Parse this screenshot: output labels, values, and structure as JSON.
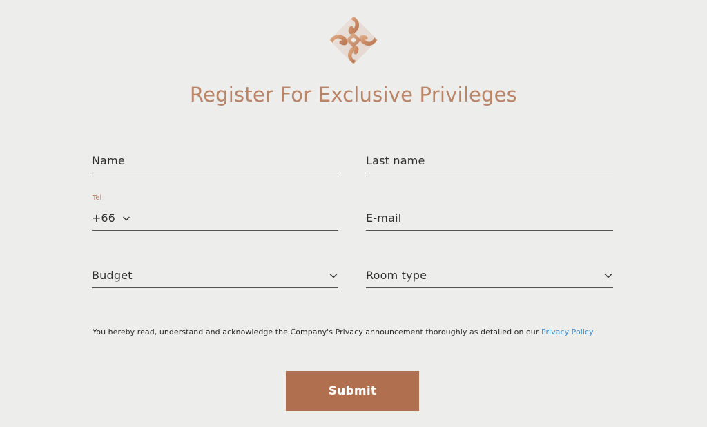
{
  "brand": {
    "logo_icon": "diamond-petal-logo-icon",
    "accent_color": "#bb8466",
    "button_color": "#b06f4e",
    "link_color": "#3a8ed6"
  },
  "header": {
    "title": "Register For Exclusive Privileges"
  },
  "form": {
    "name": {
      "placeholder": "Name"
    },
    "last_name": {
      "placeholder": "Last name"
    },
    "tel": {
      "label": "Tel",
      "country_code": "+66",
      "icon": "chevron-down-icon"
    },
    "email": {
      "placeholder": "E-mail"
    },
    "budget": {
      "selected": "Budget",
      "icon": "chevron-down-icon"
    },
    "room_type": {
      "selected": "Room type",
      "icon": "chevron-down-icon"
    }
  },
  "consent": {
    "text": "You hereby read, understand and acknowledge the Company's Privacy announcement thoroughly as detailed on our ",
    "link_label": "Privacy Policy"
  },
  "submit": {
    "label": "Submit"
  }
}
